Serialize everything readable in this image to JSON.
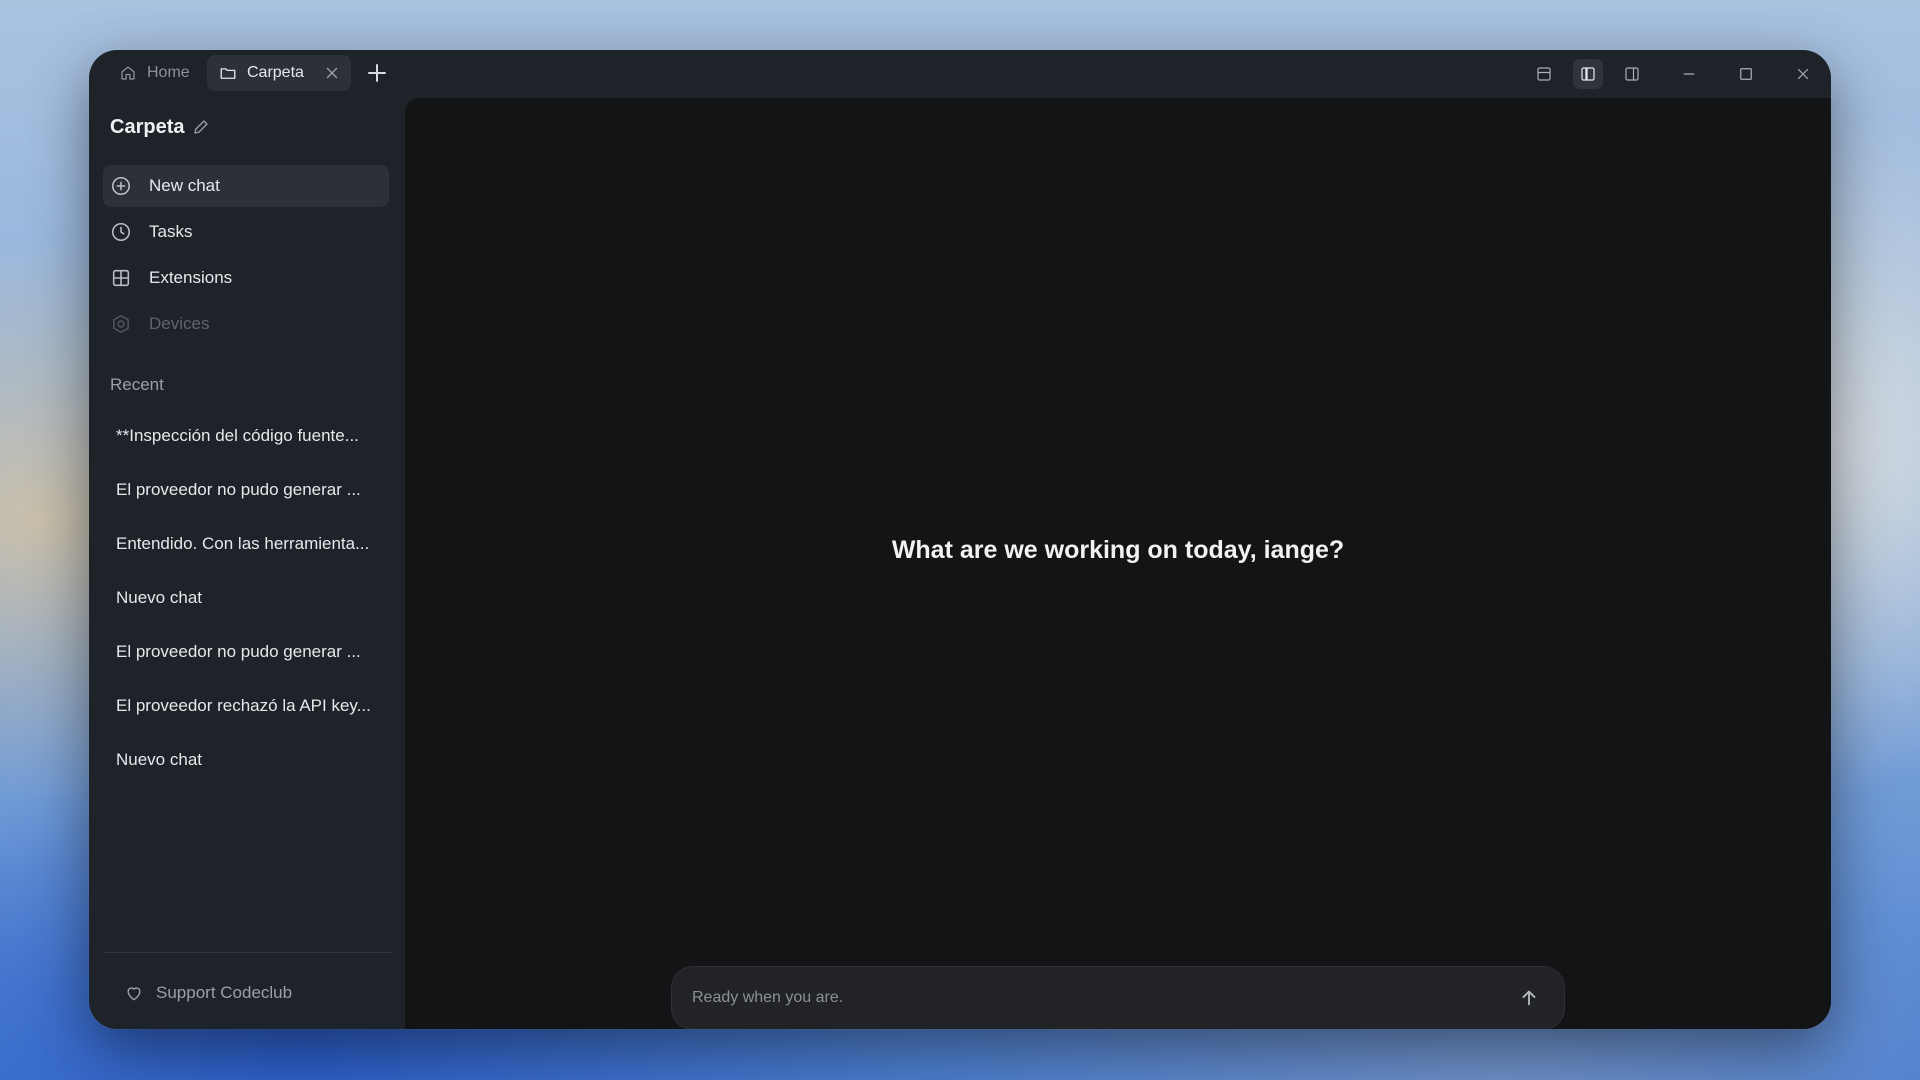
{
  "tabs": [
    {
      "label": "Home",
      "icon": "home-icon",
      "active": false
    },
    {
      "label": "Carpeta",
      "icon": "folder-icon",
      "active": true
    }
  ],
  "sidebar": {
    "folder_title": "Carpeta",
    "nav": [
      {
        "label": "New chat",
        "icon": "plus-circle-icon",
        "selected": true
      },
      {
        "label": "Tasks",
        "icon": "clock-icon"
      },
      {
        "label": "Extensions",
        "icon": "grid-icon"
      },
      {
        "label": "Devices",
        "icon": "gear-icon",
        "disabled": true
      }
    ],
    "recent_heading": "Recent",
    "recent": [
      "**Inspección del código fuente...",
      "El proveedor no pudo generar ...",
      "Entendido. Con las herramienta...",
      "Nuevo chat",
      "El proveedor no pudo generar ...",
      "El proveedor rechazó la API key...",
      "Nuevo chat"
    ],
    "support_label": "Support Codeclub"
  },
  "main": {
    "greeting": "What are we working on today, iange?",
    "composer_placeholder": "Ready when you are."
  },
  "colors": {
    "window_bg": "#1e2229",
    "main_bg": "#131416",
    "selected_bg": "#2c3139"
  }
}
